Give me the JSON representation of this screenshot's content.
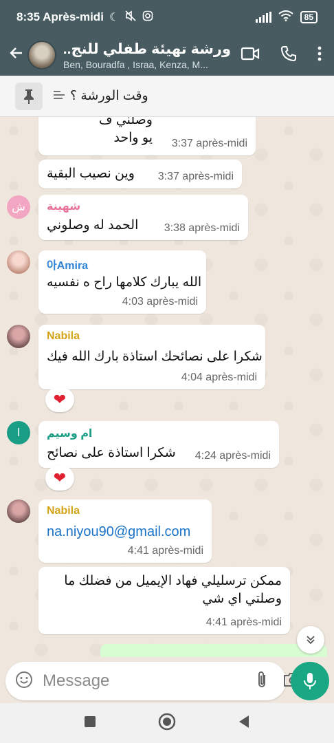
{
  "status_bar": {
    "time": "8:35 Après-midi",
    "battery": "85"
  },
  "header": {
    "title": "ورشة تهيئة طفلي للنج...",
    "members": "Ben, Bouradfa , Israa, Kenza, M..."
  },
  "pinned": {
    "text": "وقت الورشة ؟"
  },
  "messages": [
    {
      "text": "وصلني ف\nيو واحد",
      "time": "3:37 après-midi"
    },
    {
      "text": "وين نصيب البقية",
      "time": "3:37 après-midi"
    },
    {
      "avatar_letter": "ش",
      "sender": "شهينة",
      "text": "الحمد له وصلوني",
      "time": "3:38 après-midi"
    },
    {
      "sender": "아Amira",
      "text": "الله يبارك كلامها راح ه نفسيه",
      "time": "4:03 après-midi"
    },
    {
      "sender": "Nabila",
      "text": "شكرا على نصائحك استاذة بارك الله فيك",
      "time": "4:04 après-midi",
      "reaction": "❤"
    },
    {
      "avatar_letter": "ا",
      "sender": "ام وسيم",
      "text": "شكرا استاذة على نصائح",
      "time": "4:24 après-midi",
      "reaction": "❤"
    },
    {
      "sender": "Nabila",
      "text": "na.niyou90@gmail.com",
      "time": "4:41 après-midi"
    },
    {
      "text": "ممكن ترسليلي فهاد الإيميل من فضلك ما\nوصلتي اي شي",
      "time": "4:41 après-midi"
    }
  ],
  "input": {
    "placeholder": "Message"
  },
  "colors": {
    "header": "#475b61",
    "accent": "#1aa884",
    "link": "#1a73c8",
    "sender_pink": "#e8739a",
    "sender_blue": "#2f84d6",
    "sender_gold": "#d4a418",
    "sender_teal": "#1a9e86"
  }
}
